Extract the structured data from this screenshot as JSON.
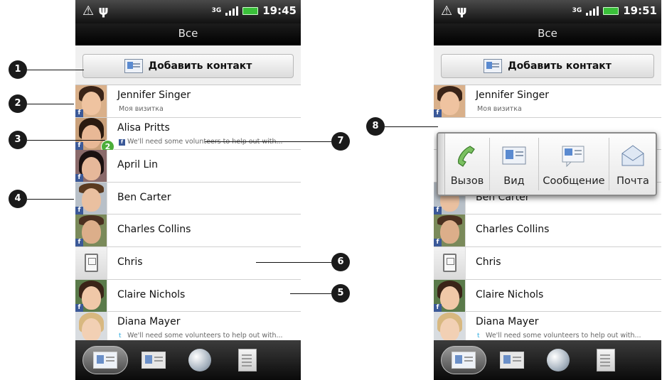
{
  "left_phone": {
    "status": {
      "signal_type": "3G",
      "time": "19:45"
    },
    "title": "Все",
    "add_contact_label": "Добавить контакт",
    "contacts": [
      {
        "name": "Jennifer Singer",
        "sub": "Моя визитка",
        "avatar": "photo-woman-dark-hair",
        "facebook": true
      },
      {
        "name": "Alisa Pritts",
        "sub": "We'll need some volunteers to help out with...",
        "avatar": "photo-woman-curly-hair",
        "facebook": true,
        "badge": "2"
      },
      {
        "name": "April Lin",
        "avatar": "photo-woman-dark-hair",
        "facebook": true
      },
      {
        "name": "Ben Carter",
        "avatar": "photo-man",
        "facebook": true
      },
      {
        "name": "Charles Collins",
        "avatar": "photo-man",
        "facebook": true
      },
      {
        "name": "Chris",
        "avatar": "sim-card-icon",
        "facebook": false
      },
      {
        "name": "Claire Nichols",
        "avatar": "photo-woman",
        "facebook": true
      },
      {
        "name": "Diana Mayer",
        "sub": "We'll need some volunteers to help out with...",
        "avatar": "photo-woman-blonde",
        "facebook": false,
        "twitter": true
      }
    ],
    "tabs": [
      "people-tab-icon",
      "groups-tab-icon",
      "online-directory-icon",
      "call-history-icon"
    ]
  },
  "right_phone": {
    "status": {
      "signal_type": "3G",
      "time": "19:51"
    },
    "title": "Все",
    "add_contact_label": "Добавить контакт",
    "contacts_visible": [
      {
        "name": "Jennifer Singer",
        "sub": "Моя визитка"
      },
      {
        "name": "Ben Carter"
      },
      {
        "name": "Charles Collins"
      },
      {
        "name": "Chris"
      },
      {
        "name": "Claire Nichols"
      },
      {
        "name": "Diana Mayer",
        "sub": "We'll need some volunteers to help out with..."
      }
    ],
    "quick_contact": {
      "actions": [
        {
          "label": "Вызов",
          "icon": "phone-handset-icon"
        },
        {
          "label": "Вид",
          "icon": "contact-card-icon"
        },
        {
          "label": "Сообщение",
          "icon": "message-icon"
        },
        {
          "label": "Почта",
          "icon": "mail-icon"
        }
      ]
    }
  },
  "callouts": [
    "1",
    "2",
    "3",
    "4",
    "5",
    "6",
    "7",
    "8"
  ],
  "colors": {
    "facebook": "#3b5998",
    "badge": "#4cae3a",
    "battery": "#3ac03a",
    "twitter": "#2aa9e0"
  }
}
